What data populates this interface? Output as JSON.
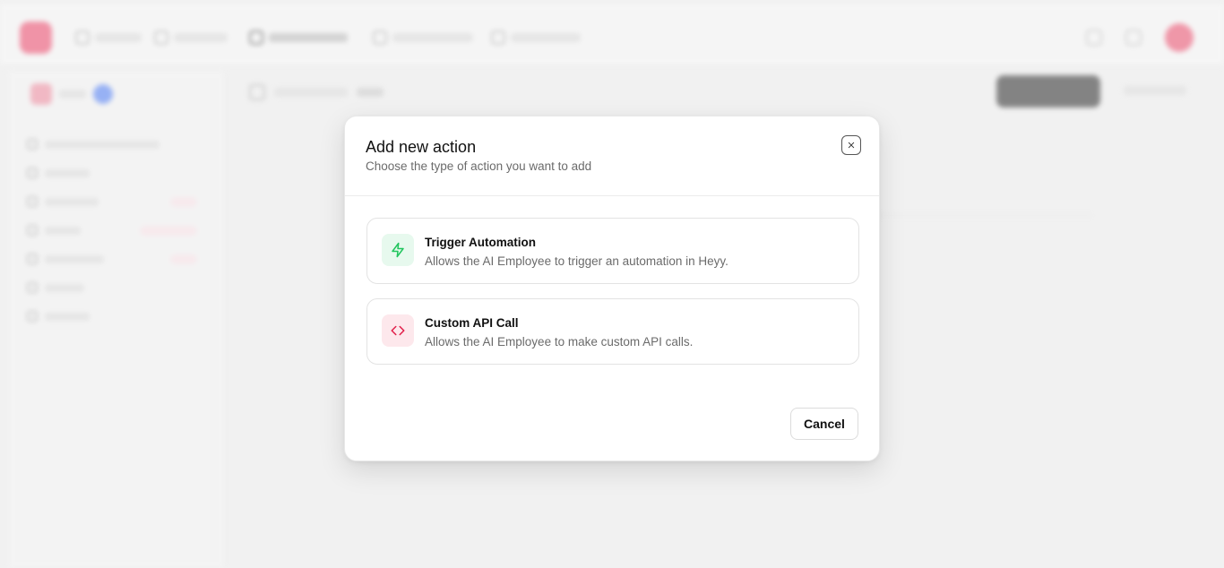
{
  "modal": {
    "title": "Add new action",
    "subtitle": "Choose the type of action you want to add",
    "close_icon": "close-icon",
    "options": [
      {
        "title": "Trigger Automation",
        "description": "Allows the AI Employee to trigger an automation in Heyy.",
        "icon": "lightning-bolt-icon",
        "icon_color": "#22c55e",
        "icon_bg": "#e7f9ee"
      },
      {
        "title": "Custom API Call",
        "description": "Allows the AI Employee to make custom API calls.",
        "icon": "code-brackets-icon",
        "icon_color": "#e11d48",
        "icon_bg": "#fde8ec"
      }
    ],
    "cancel_label": "Cancel"
  },
  "colors": {
    "brand": "#f0476b",
    "overlay_bg": "#f1f1f1"
  }
}
